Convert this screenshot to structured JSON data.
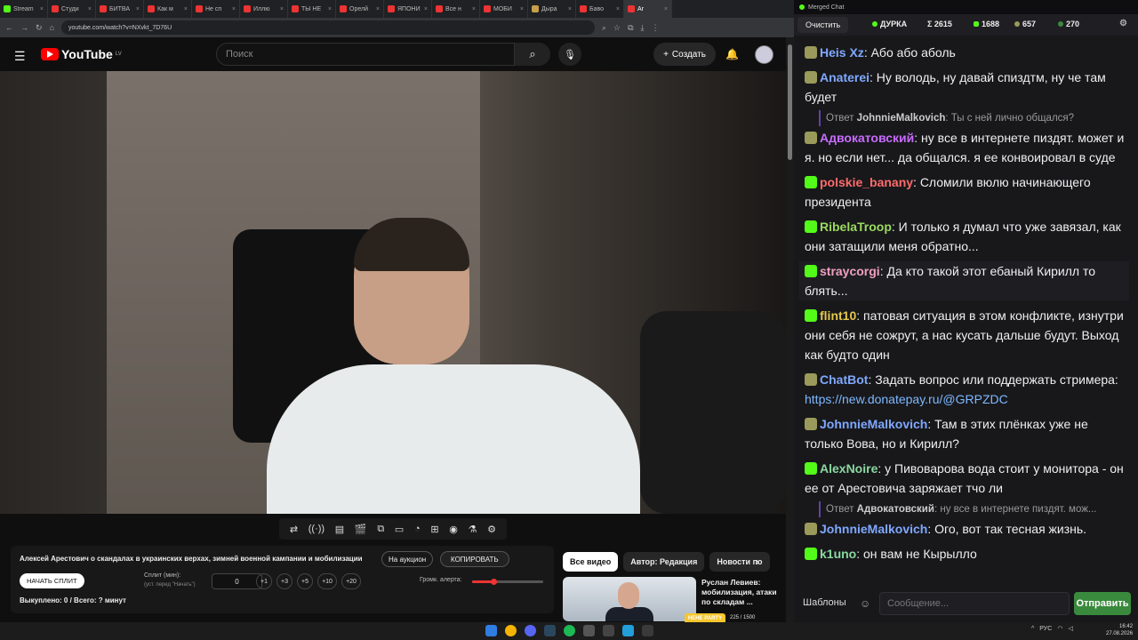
{
  "browser": {
    "tabs": [
      {
        "label": "Stream",
        "color": "#53fc18"
      },
      {
        "label": "Студи",
        "color": "#e33"
      },
      {
        "label": "БИТВА",
        "color": "#e33"
      },
      {
        "label": "Как м",
        "color": "#e33"
      },
      {
        "label": "Не сп",
        "color": "#e33"
      },
      {
        "label": "Иллю",
        "color": "#e33"
      },
      {
        "label": "ТЫ НЕ",
        "color": "#e33"
      },
      {
        "label": "Орелй",
        "color": "#e33"
      },
      {
        "label": "ЯПОНИ",
        "color": "#e33"
      },
      {
        "label": "Все н",
        "color": "#e33"
      },
      {
        "label": "МОБИ",
        "color": "#e33"
      },
      {
        "label": "Дыра",
        "color": "#c8a04a"
      },
      {
        "label": "Баво",
        "color": "#e33"
      },
      {
        "label": "Ar",
        "color": "#e33"
      }
    ],
    "url": "youtube.com/watch?v=NXvkt_7D76U"
  },
  "youtube": {
    "logo_text": "YouTube",
    "region": "LV",
    "search_placeholder": "Поиск",
    "create_label": "Создать"
  },
  "video": {
    "title": "Алексей Арестович о скандалах в украинских верхах, зимней военной кампании и мобилизации",
    "watermark": "P"
  },
  "panel": {
    "auction_label": "На аукцион",
    "copy_label": "КОПИРОВАТЬ",
    "split_button": "НАЧАТЬ СПЛИТ",
    "split_label": "Сплит (мин):",
    "split_hint": "(уст. перед \"Начать\")",
    "split_value": "0",
    "increments": [
      "+1",
      "+3",
      "+5",
      "+10",
      "+20"
    ],
    "alert_label": "Громк. алерта:",
    "alert_level": 0.3,
    "bought": "Выкуплено: 0 / Всего: ? минут"
  },
  "recommendations": {
    "chips": [
      "Все видео",
      "Автор: Редакция",
      "Новости по"
    ],
    "item_title": "Руслан Левиев: мобилизация, атаки по складам ...",
    "party_badge": "НЕНЕ PARTY",
    "party_count": "225 / 1500"
  },
  "chat": {
    "window_title": "Merged Chat",
    "clear_label": "Очистить",
    "stats": {
      "status": "ДУРКА",
      "total": "Σ 2615",
      "kick": "1688",
      "youtube": "657",
      "other": "270"
    },
    "messages": [
      {
        "badge": "yt",
        "user": "Heis Xz",
        "color": "#7fa8ff",
        "text": "Або або аболь"
      },
      {
        "badge": "yt",
        "user": "Anaterei",
        "color": "#7fa8ff",
        "text": "Ну володь, ну давай спиздтм, ну че там будет"
      },
      {
        "badge": "yt",
        "user": "Адвокатовский",
        "color": "#c86bff",
        "text": "ну все в интернете пиздят. может и я. но если нет... да общался. я ее конвоировал в суде",
        "reply_user": "JohnnieMalkovich",
        "reply_text": "Ты с ней лично общался?"
      },
      {
        "badge": "kick",
        "user": "polskie_banany",
        "color": "#ff6b6b",
        "text": "Сломили вюлю начинающего президента"
      },
      {
        "badge": "kick",
        "user": "RibelaTroop",
        "color": "#9ad95f",
        "text": "И только я думал что уже завязал, как они затащили меня обратно..."
      },
      {
        "badge": "kick",
        "user": "straycorgi",
        "color": "#f0a0c0",
        "text": "Да кто такой этот ебаный Кирилл то блять..."
      },
      {
        "badge": "kick",
        "user": "flint10",
        "color": "#e6c84a",
        "text": "патовая ситуация в этом конфликте, изнутри они себя не сожрут, а нас кусать дальше будут. Выход как будто один"
      },
      {
        "badge": "yt",
        "user": "ChatBot",
        "color": "#7fa8ff",
        "text": "Задать вопрос или поддержать стримера: ",
        "link": "https://new.donatepay.ru/@GRPZDC"
      },
      {
        "badge": "yt",
        "user": "JohnnieMalkovich",
        "color": "#7fa8ff",
        "text": "Там в этих плёнках уже не только Вова, но и Кирилл?"
      },
      {
        "badge": "kick",
        "user": "AlexNoire",
        "color": "#8ad9a0",
        "text": "у Пивоварова вода стоит у монитора - он ее от Арестовича заряжает тчо ли"
      },
      {
        "badge": "yt",
        "user": "JohnnieMalkovich",
        "color": "#7fa8ff",
        "text": "Ого, вот так тесная жизнь.",
        "reply_user": "Адвокатовский",
        "reply_text": "ну все в интернете пиздят. мож..."
      },
      {
        "badge": "kick",
        "user": "k1uno",
        "color": "#8ad9a0",
        "text": "он вам не Кырылло"
      }
    ],
    "templates_label": "Шаблоны",
    "input_placeholder": "Сообщение...",
    "send_label": "Отправить"
  },
  "taskbar": {
    "lang": "РУС",
    "time": "16:42",
    "date": "27.08.2026"
  }
}
